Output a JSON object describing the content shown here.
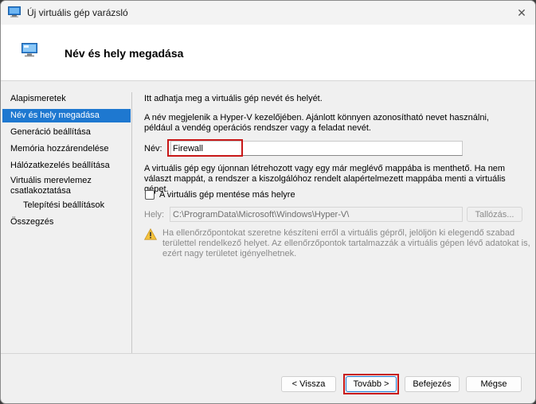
{
  "window": {
    "title": "Új virtuális gép varázsló"
  },
  "header": {
    "title": "Név és hely megadása"
  },
  "nav": {
    "items": [
      {
        "label": "Alapismeretek"
      },
      {
        "label": "Név és hely megadása"
      },
      {
        "label": "Generáció beállítása"
      },
      {
        "label": "Memória hozzárendelése"
      },
      {
        "label": "Hálózatkezelés beállítása"
      },
      {
        "label": "Virtuális merevlemez csatlakoztatása"
      },
      {
        "label": "Telepítési beállítások"
      },
      {
        "label": "Összegzés"
      }
    ],
    "active_index": 1
  },
  "main": {
    "intro": "Itt adhatja meg a virtuális gép nevét és helyét.",
    "description": "A név megjelenik a Hyper-V kezelőjében. Ajánlott könnyen azonosítható nevet használni, például a vendég operációs rendszer vagy a feladat nevét.",
    "name_label": "Név:",
    "name_value": "Firewall",
    "folder_info": "A virtuális gép egy újonnan létrehozott vagy egy már meglévő mappába is menthető. Ha nem választ mappát, a rendszer a kiszolgálóhoz rendelt alapértelmezett mappába menti a virtuális gépet.",
    "checkbox_label": "A virtuális gép mentése más helyre",
    "checkbox_checked": false,
    "location_label": "Hely:",
    "location_value": "C:\\ProgramData\\Microsoft\\Windows\\Hyper-V\\",
    "browse_label": "Tallózás...",
    "warning_text": "Ha ellenőrzőpontokat szeretne készíteni erről a virtuális gépről, jelöljön ki elegendő szabad területtel rendelkező helyet. Az ellenőrzőpontok tartalmazzák a virtuális gépen lévő adatokat is, ezért nagy területet igényelhetnek."
  },
  "buttons": {
    "back": "< Vissza",
    "next": "Tovább >",
    "finish": "Befejezés",
    "cancel": "Mégse"
  },
  "colors": {
    "accent": "#1e78d0",
    "highlight_box": "#c81818"
  }
}
